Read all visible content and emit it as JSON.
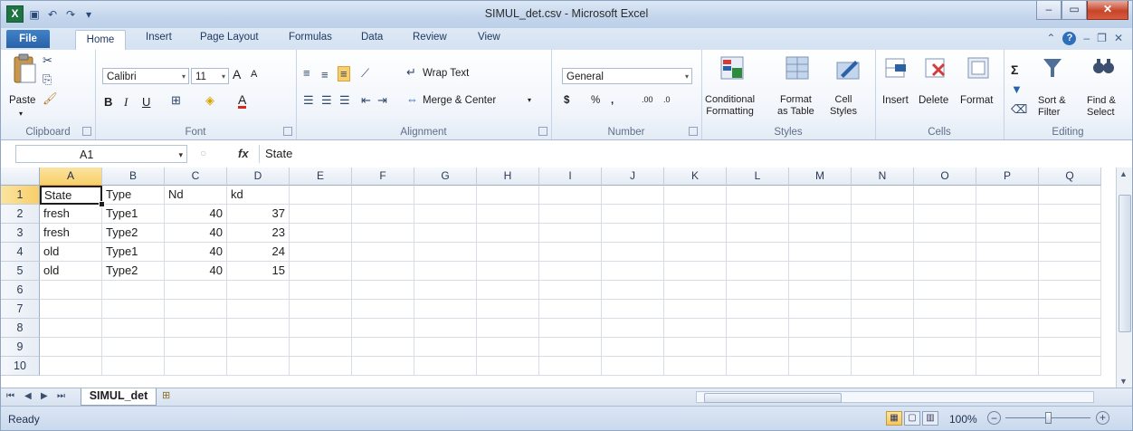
{
  "window": {
    "title": "SIMUL_det.csv - Microsoft Excel",
    "logo_letter": "X"
  },
  "tabs": [
    "File",
    "Home",
    "Insert",
    "Page Layout",
    "Formulas",
    "Data",
    "Review",
    "View"
  ],
  "ribbon": {
    "clipboard": {
      "label": "Clipboard",
      "paste": "Paste"
    },
    "font": {
      "label": "Font",
      "name": "Calibri",
      "size": "11",
      "bold": "B",
      "italic": "I",
      "underline": "U",
      "grow": "A",
      "shrink": "A",
      "font_color_letter": "A"
    },
    "alignment": {
      "label": "Alignment",
      "wrap": "Wrap Text",
      "merge": "Merge & Center"
    },
    "number": {
      "label": "Number",
      "format": "General",
      "currency": "$",
      "percent": "%",
      "comma": ",",
      "inc": ".00",
      "dec": ".0"
    },
    "styles": {
      "label": "Styles",
      "conditional": [
        "Conditional",
        "Formatting"
      ],
      "format_table": [
        "Format",
        "as Table"
      ],
      "cell_styles": [
        "Cell",
        "Styles"
      ]
    },
    "cells": {
      "label": "Cells",
      "insert": "Insert",
      "delete": "Delete",
      "format": "Format"
    },
    "editing": {
      "label": "Editing",
      "sort": [
        "Sort &",
        "Filter"
      ],
      "find": [
        "Find &",
        "Select"
      ],
      "sigma": "Σ"
    }
  },
  "formula_bar": {
    "name_box": "A1",
    "fx": "fx",
    "content": "State"
  },
  "grid": {
    "columns": [
      "A",
      "B",
      "C",
      "D",
      "E",
      "F",
      "G",
      "H",
      "I",
      "J",
      "K",
      "L",
      "M",
      "N",
      "O",
      "P",
      "Q"
    ],
    "rows": [
      "1",
      "2",
      "3",
      "4",
      "5",
      "6",
      "7",
      "8",
      "9",
      "10"
    ],
    "cells": [
      [
        "State",
        "Type",
        "Nd",
        "kd"
      ],
      [
        "fresh",
        "Type1",
        "40",
        "37"
      ],
      [
        "fresh",
        "Type2",
        "40",
        "23"
      ],
      [
        "old",
        "Type1",
        "40",
        "24"
      ],
      [
        "old",
        "Type2",
        "40",
        "15"
      ]
    ]
  },
  "sheets": {
    "active": "SIMUL_det"
  },
  "status": {
    "ready": "Ready",
    "zoom": "100%",
    "zoom_fraction": 0.5
  },
  "colors": {
    "accent": "#2a62a8",
    "selection": "#f8cf69",
    "excel_green": "#1f7244"
  }
}
